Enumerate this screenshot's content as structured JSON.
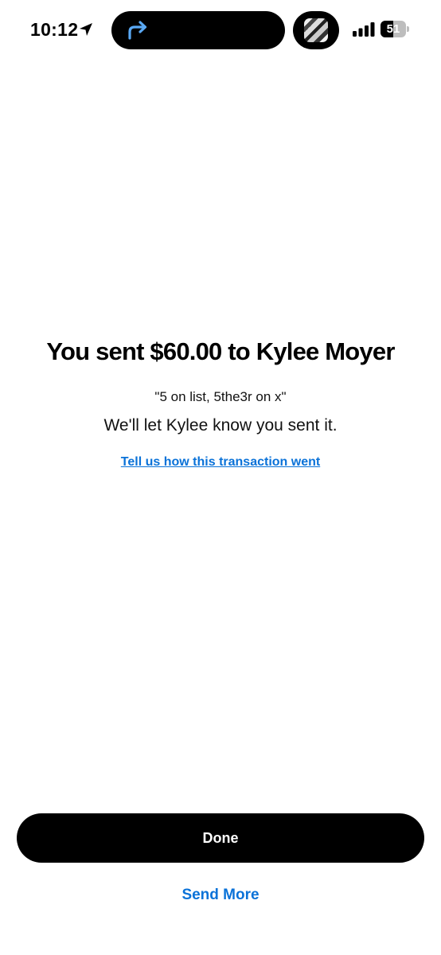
{
  "status_bar": {
    "time": "10:12",
    "battery_level": "51",
    "battery_percent": 51,
    "location_icon": "location-arrow-icon",
    "live_activity_icon": "forward-arrow-icon",
    "signal_icon": "cellular-signal-icon",
    "colors": {
      "island": "#000000",
      "forward_arrow": "#5aa9f5"
    }
  },
  "confirmation": {
    "title": "You sent $60.00 to Kylee Moyer",
    "memo": "\"5 on list, 5the3r on x\"",
    "subtitle": "We'll let Kylee know you sent it.",
    "feedback_link": "Tell us how this transaction went"
  },
  "actions": {
    "done_label": "Done",
    "send_more_label": "Send More"
  },
  "colors": {
    "background": "#ffffff",
    "primary_button": "#000000",
    "link": "#0a72d8"
  }
}
